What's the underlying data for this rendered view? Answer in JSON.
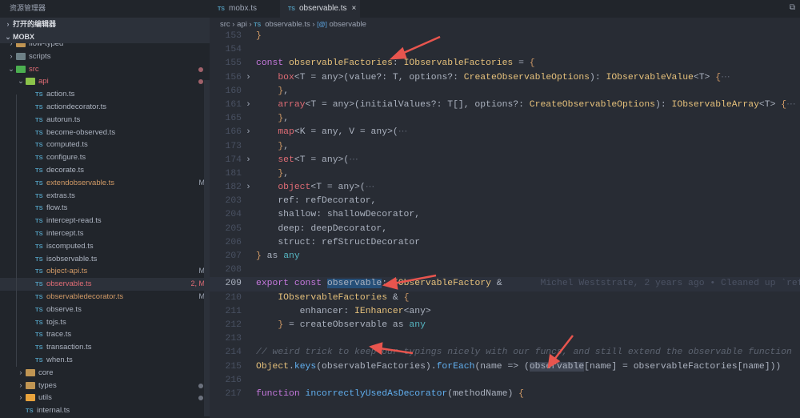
{
  "sidebar": {
    "title": "资源管理器",
    "sections": {
      "open_editors": "打开的编辑器",
      "project": "MOBX"
    },
    "items": [
      {
        "label": "flow-typed",
        "kind": "folder",
        "depth": 1,
        "expanded": false,
        "color": "#c09553"
      },
      {
        "label": "scripts",
        "kind": "folder",
        "depth": 1,
        "expanded": false,
        "color": "#6d8086"
      },
      {
        "label": "src",
        "kind": "folder",
        "depth": 1,
        "expanded": true,
        "color": "#4caf50",
        "status": "err-dot"
      },
      {
        "label": "api",
        "kind": "folder",
        "depth": 2,
        "expanded": true,
        "color": "#8bc34a",
        "status": "err-dot"
      },
      {
        "label": "action.ts",
        "kind": "ts",
        "depth": 3
      },
      {
        "label": "actiondecorator.ts",
        "kind": "ts",
        "depth": 3
      },
      {
        "label": "autorun.ts",
        "kind": "ts",
        "depth": 3
      },
      {
        "label": "become-observed.ts",
        "kind": "ts",
        "depth": 3
      },
      {
        "label": "computed.ts",
        "kind": "ts",
        "depth": 3
      },
      {
        "label": "configure.ts",
        "kind": "ts",
        "depth": 3
      },
      {
        "label": "decorate.ts",
        "kind": "ts",
        "depth": 3
      },
      {
        "label": "extendobservable.ts",
        "kind": "ts",
        "depth": 3,
        "badge": "M"
      },
      {
        "label": "extras.ts",
        "kind": "ts",
        "depth": 3
      },
      {
        "label": "flow.ts",
        "kind": "ts",
        "depth": 3
      },
      {
        "label": "intercept-read.ts",
        "kind": "ts",
        "depth": 3
      },
      {
        "label": "intercept.ts",
        "kind": "ts",
        "depth": 3
      },
      {
        "label": "iscomputed.ts",
        "kind": "ts",
        "depth": 3
      },
      {
        "label": "isobservable.ts",
        "kind": "ts",
        "depth": 3
      },
      {
        "label": "object-api.ts",
        "kind": "ts",
        "depth": 3,
        "badge": "M"
      },
      {
        "label": "observable.ts",
        "kind": "ts",
        "depth": 3,
        "badge": "2, M",
        "selected": true,
        "error": true
      },
      {
        "label": "observabledecorator.ts",
        "kind": "ts",
        "depth": 3,
        "badge": "M"
      },
      {
        "label": "observe.ts",
        "kind": "ts",
        "depth": 3
      },
      {
        "label": "tojs.ts",
        "kind": "ts",
        "depth": 3
      },
      {
        "label": "trace.ts",
        "kind": "ts",
        "depth": 3
      },
      {
        "label": "transaction.ts",
        "kind": "ts",
        "depth": 3
      },
      {
        "label": "when.ts",
        "kind": "ts",
        "depth": 3
      },
      {
        "label": "core",
        "kind": "folder",
        "depth": 2,
        "expanded": false,
        "color": "#c09553"
      },
      {
        "label": "types",
        "kind": "folder",
        "depth": 2,
        "expanded": false,
        "color": "#c09553",
        "status": "dot"
      },
      {
        "label": "utils",
        "kind": "folder",
        "depth": 2,
        "expanded": false,
        "color": "#e8a33d",
        "status": "dot"
      },
      {
        "label": "internal.ts",
        "kind": "ts",
        "depth": 2
      }
    ]
  },
  "tabs": [
    {
      "label": "mobx.ts",
      "active": false
    },
    {
      "label": "observable.ts",
      "active": true
    }
  ],
  "ts_icon": "TS",
  "breadcrumb": [
    "src",
    "api",
    "observable.ts",
    "observable"
  ],
  "editor": {
    "current_line": "209",
    "lines": [
      {
        "n": "153",
        "t": [
          [
            "}",
            "br"
          ]
        ]
      },
      {
        "n": "154",
        "t": []
      },
      {
        "n": "155",
        "t": [
          [
            "const ",
            "kw"
          ],
          [
            "observableFactories",
            "var"
          ],
          [
            ": ",
            "pl"
          ],
          [
            "IObservableFactories",
            "ty"
          ],
          [
            " = ",
            "pl"
          ],
          [
            "{",
            "br"
          ]
        ]
      },
      {
        "n": "156",
        "fold": true,
        "t": [
          [
            "    box",
            "prop"
          ],
          [
            "<T = ",
            "pl"
          ],
          [
            "any",
            "pl"
          ],
          [
            ">(",
            "pl"
          ],
          [
            "value?: T, options?: ",
            "pl"
          ],
          [
            "CreateObservableOptions",
            "ty"
          ],
          [
            "): ",
            "pl"
          ],
          [
            "IObservableValue",
            "ty"
          ],
          [
            "<T> ",
            "pl"
          ],
          [
            "{",
            "br"
          ],
          [
            "⋯",
            "dim"
          ]
        ]
      },
      {
        "n": "160",
        "t": [
          [
            "    }",
            "br"
          ],
          [
            ",",
            "pl"
          ]
        ]
      },
      {
        "n": "161",
        "fold": true,
        "t": [
          [
            "    array",
            "prop"
          ],
          [
            "<T = any>(initialValues?: T[], options?: ",
            "pl"
          ],
          [
            "CreateObservableOptions",
            "ty"
          ],
          [
            "): ",
            "pl"
          ],
          [
            "IObservableArray",
            "ty"
          ],
          [
            "<T> ",
            "pl"
          ],
          [
            "{",
            "br"
          ],
          [
            "⋯",
            "dim"
          ]
        ]
      },
      {
        "n": "165",
        "t": [
          [
            "    }",
            "br"
          ],
          [
            ",",
            "pl"
          ]
        ]
      },
      {
        "n": "166",
        "fold": true,
        "t": [
          [
            "    map",
            "prop"
          ],
          [
            "<K = any, V = any>(",
            "pl"
          ],
          [
            "⋯",
            "dim"
          ]
        ]
      },
      {
        "n": "173",
        "t": [
          [
            "    }",
            "br"
          ],
          [
            ",",
            "pl"
          ]
        ]
      },
      {
        "n": "174",
        "fold": true,
        "t": [
          [
            "    set",
            "prop"
          ],
          [
            "<T = any>(",
            "pl"
          ],
          [
            "⋯",
            "dim"
          ]
        ]
      },
      {
        "n": "181",
        "t": [
          [
            "    }",
            "br"
          ],
          [
            ",",
            "pl"
          ]
        ]
      },
      {
        "n": "182",
        "fold": true,
        "t": [
          [
            "    object",
            "prop"
          ],
          [
            "<T = any>(",
            "pl"
          ],
          [
            "⋯",
            "dim"
          ]
        ]
      },
      {
        "n": "203",
        "t": [
          [
            "    ref: refDecorator,",
            "pl"
          ]
        ]
      },
      {
        "n": "204",
        "t": [
          [
            "    shallow: shallowDecorator,",
            "pl"
          ]
        ]
      },
      {
        "n": "205",
        "t": [
          [
            "    deep: deepDecorator,",
            "pl"
          ]
        ]
      },
      {
        "n": "206",
        "t": [
          [
            "    struct: refStructDecorator",
            "pl"
          ]
        ]
      },
      {
        "n": "207",
        "t": [
          [
            "}",
            "br"
          ],
          [
            " as ",
            "pl"
          ],
          [
            "any",
            "cy"
          ]
        ]
      },
      {
        "n": "208",
        "t": []
      },
      {
        "n": "209",
        "t": [
          [
            "export ",
            "kw"
          ],
          [
            "const ",
            "kw"
          ],
          [
            "observable",
            "hl"
          ],
          [
            ": ",
            "pl"
          ],
          [
            "IObservableFactory",
            "ty"
          ],
          [
            " & ",
            "pl"
          ],
          [
            "      Michel Weststrate, 2 years ago • Cleaned up `ref",
            "blame"
          ]
        ]
      },
      {
        "n": "210",
        "t": [
          [
            "    IObservableFactories",
            "ty"
          ],
          [
            " & ",
            "pl"
          ],
          [
            "{",
            "br"
          ]
        ]
      },
      {
        "n": "211",
        "t": [
          [
            "        enhancer: ",
            "pl"
          ],
          [
            "IEnhancer",
            "ty"
          ],
          [
            "<any>",
            "pl"
          ]
        ]
      },
      {
        "n": "212",
        "t": [
          [
            "    }",
            "br"
          ],
          [
            " = createObservable as ",
            "pl"
          ],
          [
            "any",
            "cy"
          ]
        ]
      },
      {
        "n": "213",
        "t": []
      },
      {
        "n": "214",
        "t": [
          [
            "// weird trick to keep our typings nicely with our funcs, and still extend the observable function",
            "cm"
          ]
        ]
      },
      {
        "n": "215",
        "t": [
          [
            "Object",
            "ty"
          ],
          [
            ".",
            "pl"
          ],
          [
            "keys",
            "fn"
          ],
          [
            "(observableFactories).",
            "pl"
          ],
          [
            "forEach",
            "fn"
          ],
          [
            "(name => (",
            "pl"
          ],
          [
            "observable",
            "hl2"
          ],
          [
            "[name] = observableFactories[name]))",
            "pl"
          ]
        ]
      },
      {
        "n": "216",
        "t": []
      },
      {
        "n": "217",
        "t": [
          [
            "function ",
            "kw"
          ],
          [
            "incorrectlyUsedAsDecorator",
            "fn"
          ],
          [
            "(methodName) ",
            "pl"
          ],
          [
            "{",
            "br"
          ]
        ]
      }
    ]
  }
}
